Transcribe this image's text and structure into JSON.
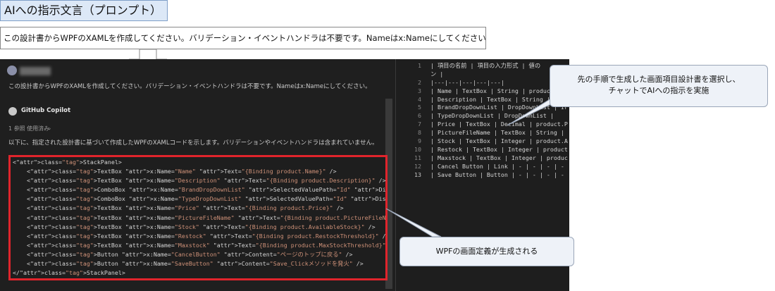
{
  "prompt_title": "AIへの指示文言（プロンプト）",
  "prompt_text": "この設計書からWPFのXAMLを作成してください。バリデーション・イベントハンドラは不要です。Nameはx:Nameにしてください。",
  "chat": {
    "user_message": "この設計書からWPFのXAMLを作成してください。バリデーション・イベントハンドラは不要です。Nameはx:Nameにしてください。",
    "assistant_name": "GitHub Copilot",
    "references_used": "1 参照 使用済み",
    "reply_text": "以下に、指定された設計書に基づいて作成したWPFのXAMLコードを示します。バリデーションやイベントハンドラは含まれていません。",
    "code_lines": [
      "<StackPanel>",
      "    <TextBox x:Name=\"Name\" Text=\"{Binding product.Name}\" />",
      "    <TextBox x:Name=\"Description\" Text=\"{Binding product.Description}\" />",
      "    <ComboBox x:Name=\"BrandDropDownList\" SelectedValuePath=\"Id\" DisplayMemberPath=\"Brand\" SelectedValue=",
      "    <ComboBox x:Name=\"TypeDropDownList\" SelectedValuePath=\"Id\" DisplayMemberPath=\"Type\" SelectedValue=\"{",
      "    <TextBox x:Name=\"Price\" Text=\"{Binding product.Price}\" />",
      "    <TextBox x:Name=\"PictureFileName\" Text=\"{Binding product.PictureFileName}\" IsReadOnly=\"True\" />",
      "    <TextBox x:Name=\"Stock\" Text=\"{Binding product.AvailableStock}\" />",
      "    <TextBox x:Name=\"Restock\" Text=\"{Binding product.RestockThreshold}\" />",
      "    <TextBox x:Name=\"Maxstock\" Text=\"{Binding product.MaxStockThreshold}\" />",
      "    <Button x:Name=\"CancelButton\" Content=\"ページのトップに戻る\" />",
      "    <Button x:Name=\"SaveButton\" Content=\"Save_Clickメソッドを発火\" />",
      "</StackPanel>"
    ]
  },
  "markdown_editor": {
    "line_numbers": [
      "1",
      "",
      "2",
      "3",
      "4",
      "5",
      "6",
      "7",
      "8",
      "9",
      "10",
      "11",
      "12",
      "13"
    ],
    "lines": [
      "| 項目の名前 | 項目の入力形式 | 値の",
      "ン |",
      "|---|---|---|---|---|",
      "| Name | TextBox | String | product",
      "| Description | TextBox | String |",
      "| BrandDropDownList | DropDownList | Ir",
      "| TypeDropDownList | DropDownList |",
      "| Price | TextBox | Decimal | product.P",
      "| PictureFileName | TextBox | String |",
      "| Stock | TextBox | Integer | product.A",
      "| Restock | TextBox | Integer | product",
      "| Maxstock | TextBox | Integer | produc",
      "| Cancel Button | Link | - | - | - | -",
      "| Save Button | Button | - | - | - | -"
    ],
    "active_line": "13"
  },
  "callouts": {
    "right_line1": "先の手順で生成した画面項目設計書を選択し、",
    "right_line2": "チャットでAIへの指示を実施",
    "bottom": "WPFの画面定義が生成される"
  },
  "colors": {
    "highlight_border": "#e0242c",
    "title_bg": "#dce8f7",
    "callout_bg": "#eef2f8"
  }
}
